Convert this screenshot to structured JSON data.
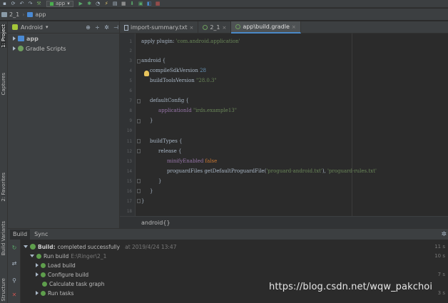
{
  "toolbar": {
    "run_config": "app",
    "icons": [
      "save-all-icon",
      "sync-icon",
      "undo-icon",
      "redo-icon",
      "hammer-icon",
      "run-icon",
      "debug-icon",
      "profile-icon",
      "apply-changes-icon",
      "stop-icon",
      "sdk-manager-icon",
      "avd-manager-icon",
      "gradle-sync-icon",
      "layout-inspector-icon"
    ]
  },
  "breadcrumb": {
    "project": "2_1",
    "module": "app"
  },
  "left_strip": {
    "tabs": [
      "1: Project",
      "Captures",
      "2: Favorites",
      "Build Variants",
      "Structure"
    ]
  },
  "project_panel": {
    "view": "Android",
    "tree": [
      {
        "label": "app",
        "expanded": false
      },
      {
        "label": "Gradle Scripts",
        "expanded": false
      }
    ]
  },
  "editor": {
    "tabs": [
      {
        "label": "import-summary.txt",
        "active": false
      },
      {
        "label": "2_1",
        "active": false
      },
      {
        "label": "app\\build.gradle",
        "active": true
      }
    ],
    "line_numbers": [
      "1",
      "2",
      "3",
      "4",
      "5",
      "6",
      "7",
      "8",
      "9",
      "10",
      "11",
      "12",
      "13",
      "14",
      "15",
      "16",
      "17",
      "18",
      "19"
    ],
    "code": {
      "l1a": "apply plugin: ",
      "l1b": "'com.android.application'",
      "l3": "android {",
      "l4a": "compileSdkVersion ",
      "l4b": "28",
      "l5a": "buildToolsVersion ",
      "l5b": "\"28.0.3\"",
      "l7": "defaultConfig {",
      "l8a": "applicationId ",
      "l8b": "\"irds.example13\"",
      "l9": "}",
      "l11": "buildTypes {",
      "l12": "release {",
      "l13a": "minifyEnabled ",
      "l13b": "false",
      "l14a": "proguardFiles getDefaultProguardFile(",
      "l14b": "'proguard-android.txt'",
      "l14c": "), ",
      "l14d": "'proguard-rules.txt'",
      "l15": "}",
      "l16": "}",
      "l17": "}"
    },
    "footer": "android{}"
  },
  "build_panel": {
    "tabs": [
      "Build",
      "Sync"
    ],
    "rows": {
      "root_bold": "Build:",
      "root_text": " completed successfully",
      "root_time": "at 2019/4/24 13:47",
      "root_right": "11 s",
      "run_build": "Run build",
      "run_path": "E:\\Ringer\\2_1",
      "run_right": "10 s",
      "load_build": "Load build",
      "configure_build": "Configure build",
      "configure_right": "7 s",
      "calculate_task_graph": "Calculate task graph",
      "run_tasks": "Run tasks",
      "run_tasks_right": "3 s"
    }
  },
  "watermark": "https://blog.csdn.net/wqw_pakchoi",
  "colors": {
    "background": "#2b2b2b",
    "panel": "#3c3f41",
    "keyword": "#cc7832",
    "string": "#6a8759",
    "number": "#6897bb",
    "success": "#5e9e4c"
  }
}
